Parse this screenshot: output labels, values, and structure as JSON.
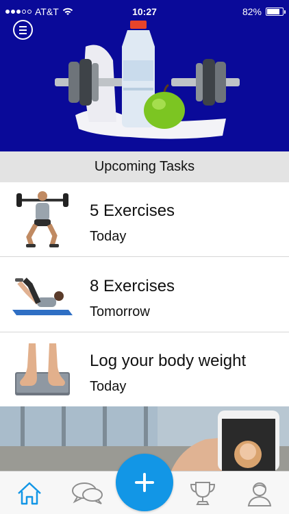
{
  "status_bar": {
    "carrier": "AT&T",
    "time": "10:27",
    "battery_text": "82%",
    "battery_level": 0.82,
    "signal_bars_filled": 3,
    "signal_bars_total": 5
  },
  "header": {
    "menu_icon": "hamburger-menu-icon",
    "hero_image": "dumbbells-water-bottle-apple-towel"
  },
  "section": {
    "title": "Upcoming Tasks"
  },
  "tasks": [
    {
      "title": "5 Exercises",
      "subtitle": "Today",
      "image": "man-barbell-squat"
    },
    {
      "title": "8 Exercises",
      "subtitle": "Tomorrow",
      "image": "woman-crunches-mat"
    },
    {
      "title": "Log your body weight",
      "subtitle": "Today",
      "image": "feet-on-scale"
    }
  ],
  "promo": {
    "image": "hand-holding-phone-gym-background"
  },
  "tabbar": {
    "items": [
      {
        "name": "home",
        "icon": "home-icon",
        "active": true
      },
      {
        "name": "messages",
        "icon": "chat-bubbles-icon",
        "active": false
      },
      {
        "name": "add",
        "icon": "plus-icon",
        "active": false
      },
      {
        "name": "achievements",
        "icon": "trophy-icon",
        "active": false
      },
      {
        "name": "profile",
        "icon": "user-icon",
        "active": false
      }
    ]
  },
  "colors": {
    "hero_background": "#0a0a99",
    "section_background": "#e3e3e3",
    "accent": "#1296e6",
    "tab_inactive": "#8e8e8e",
    "tab_active": "#1296e6"
  }
}
